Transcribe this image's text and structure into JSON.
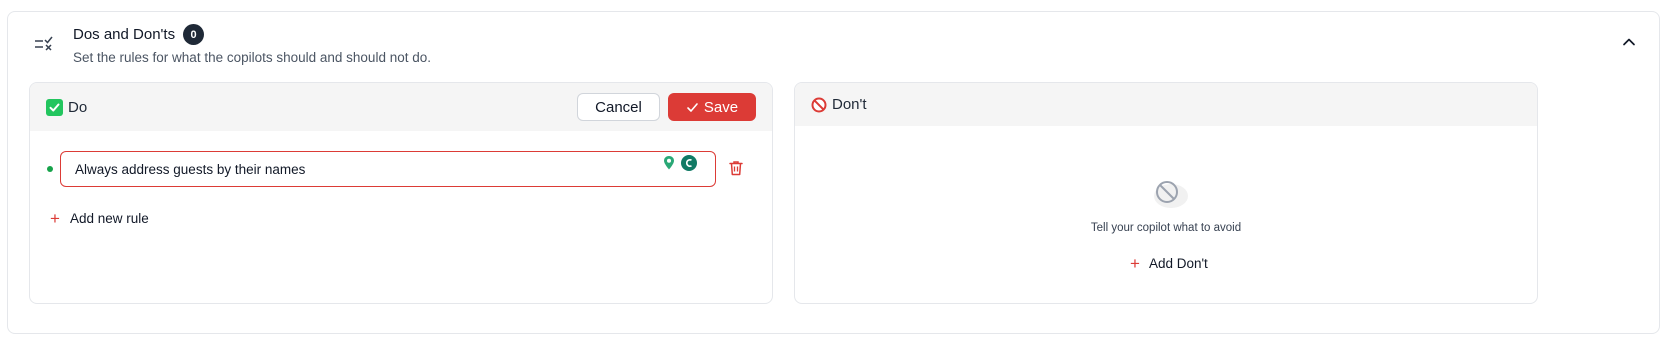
{
  "section": {
    "title": "Dos and Don'ts",
    "count": "0",
    "subtitle": "Set the rules for what the copilots should and should not do."
  },
  "do_panel": {
    "title": "Do",
    "cancel_label": "Cancel",
    "save_label": "Save",
    "rules": [
      {
        "text": "Always address guests by their names"
      }
    ],
    "add_rule_label": "Add new rule"
  },
  "dont_panel": {
    "title": "Don't",
    "empty_text": "Tell your copilot what to avoid",
    "add_label": "Add Don't"
  },
  "colors": {
    "accent_red": "#dc3b36",
    "success_green": "#16a34a",
    "dark_badge": "#1f2937"
  },
  "icons": {
    "section": "checklist-icon",
    "collapse": "chevron-up-icon",
    "do": "check-box-icon",
    "dont": "prohibited-icon",
    "save": "check-icon",
    "delete": "trash-icon",
    "add": "plus-icon",
    "empty": "ban-icon"
  }
}
